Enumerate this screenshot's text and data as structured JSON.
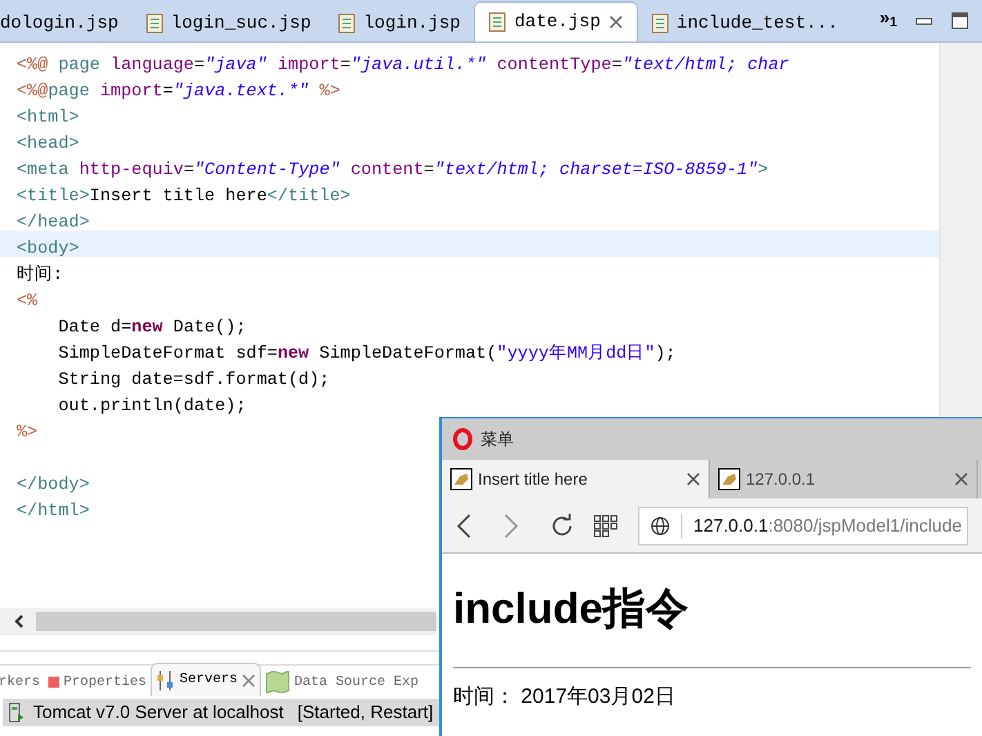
{
  "editor_tabs": [
    {
      "label": "dologin.jsp",
      "selected": false,
      "closable": false
    },
    {
      "label": "login_suc.jsp",
      "selected": false,
      "closable": false
    },
    {
      "label": "login.jsp",
      "selected": false,
      "closable": false
    },
    {
      "label": "date.jsp",
      "selected": true,
      "closable": true
    },
    {
      "label": "include_test...",
      "selected": false,
      "closable": false
    }
  ],
  "tab_overflow": "»$_{1}$",
  "code_lines": [
    {
      "highlighted": false,
      "tokens": [
        {
          "kind": "dir",
          "text": "<%@ "
        },
        {
          "kind": "tag",
          "text": "page "
        },
        {
          "kind": "attr",
          "text": "language"
        },
        {
          "kind": "text",
          "text": "="
        },
        {
          "kind": "str",
          "text": "\"java\""
        },
        {
          "kind": "attr",
          "text": " import"
        },
        {
          "kind": "text",
          "text": "="
        },
        {
          "kind": "str",
          "text": "\"java.util.*\""
        },
        {
          "kind": "attr",
          "text": " contentType"
        },
        {
          "kind": "text",
          "text": "="
        },
        {
          "kind": "str",
          "text": "\"text/html; char"
        }
      ]
    },
    {
      "highlighted": false,
      "tokens": [
        {
          "kind": "dir",
          "text": "<%@"
        },
        {
          "kind": "tag",
          "text": "page "
        },
        {
          "kind": "attr",
          "text": "import"
        },
        {
          "kind": "text",
          "text": "="
        },
        {
          "kind": "str",
          "text": "\"java.text.*\""
        },
        {
          "kind": "dir",
          "text": " %>"
        }
      ]
    },
    {
      "highlighted": false,
      "tokens": [
        {
          "kind": "tag",
          "text": "<html>"
        }
      ]
    },
    {
      "highlighted": false,
      "tokens": [
        {
          "kind": "tag",
          "text": "<head>"
        }
      ]
    },
    {
      "highlighted": false,
      "tokens": [
        {
          "kind": "tag",
          "text": "<meta "
        },
        {
          "kind": "attr",
          "text": "http-equiv"
        },
        {
          "kind": "text",
          "text": "="
        },
        {
          "kind": "str",
          "text": "\"Content-Type\""
        },
        {
          "kind": "attr",
          "text": " content"
        },
        {
          "kind": "text",
          "text": "="
        },
        {
          "kind": "str",
          "text": "\"text/html; charset=ISO-8859-1\""
        },
        {
          "kind": "tag",
          "text": ">"
        }
      ]
    },
    {
      "highlighted": false,
      "tokens": [
        {
          "kind": "tag",
          "text": "<title>"
        },
        {
          "kind": "text",
          "text": "Insert title here"
        },
        {
          "kind": "tag",
          "text": "</title>"
        }
      ]
    },
    {
      "highlighted": false,
      "tokens": [
        {
          "kind": "tag",
          "text": "</head>"
        }
      ]
    },
    {
      "highlighted": true,
      "tokens": [
        {
          "kind": "tag",
          "text": "<body>"
        }
      ]
    },
    {
      "highlighted": false,
      "tokens": [
        {
          "kind": "text",
          "text": "时间:"
        }
      ]
    },
    {
      "highlighted": false,
      "tokens": [
        {
          "kind": "dir",
          "text": "<%"
        }
      ]
    },
    {
      "highlighted": false,
      "tokens": [
        {
          "kind": "text",
          "text": "    Date d="
        },
        {
          "kind": "kw",
          "text": "new"
        },
        {
          "kind": "text",
          "text": " Date();"
        }
      ]
    },
    {
      "highlighted": false,
      "tokens": [
        {
          "kind": "text",
          "text": "    SimpleDateFormat sdf="
        },
        {
          "kind": "kw",
          "text": "new"
        },
        {
          "kind": "text",
          "text": " SimpleDateFormat("
        },
        {
          "kind": "jstr",
          "text": "\"yyyy年MM月dd日\""
        },
        {
          "kind": "text",
          "text": ");"
        }
      ]
    },
    {
      "highlighted": false,
      "tokens": [
        {
          "kind": "text",
          "text": "    String date=sdf.format(d);"
        }
      ]
    },
    {
      "highlighted": false,
      "tokens": [
        {
          "kind": "text",
          "text": "    out.println(date);"
        }
      ]
    },
    {
      "highlighted": false,
      "tokens": [
        {
          "kind": "dir",
          "text": "%>"
        }
      ]
    },
    {
      "highlighted": false
    },
    {
      "highlighted": false,
      "tokens": [
        {
          "kind": "tag",
          "text": "</body>"
        }
      ]
    },
    {
      "highlighted": false,
      "tokens": [
        {
          "kind": "tag",
          "text": "</html>"
        }
      ]
    }
  ],
  "bottom_tabs": [
    {
      "label": "rkers",
      "kind": "plain",
      "selected": false,
      "closable": false
    },
    {
      "label": "Properties",
      "kind": "properties",
      "selected": false,
      "closable": false
    },
    {
      "label": "Servers",
      "kind": "servers",
      "selected": true,
      "closable": true
    },
    {
      "label": "Data Source Exp",
      "kind": "datasource",
      "selected": false,
      "closable": false
    }
  ],
  "server": {
    "name": "Tomcat v7.0 Server at localhost",
    "state": "[Started, Restart]"
  },
  "browser": {
    "title": "菜单",
    "tabs": [
      {
        "label": "Insert title here",
        "selected": true
      },
      {
        "label": "127.0.0.1",
        "selected": false
      }
    ],
    "url_host": "127.0.0.1",
    "url_path": ":8080/jspModel1/include",
    "heading": "include指令",
    "body_text": "时间： 2017年03月02日"
  }
}
